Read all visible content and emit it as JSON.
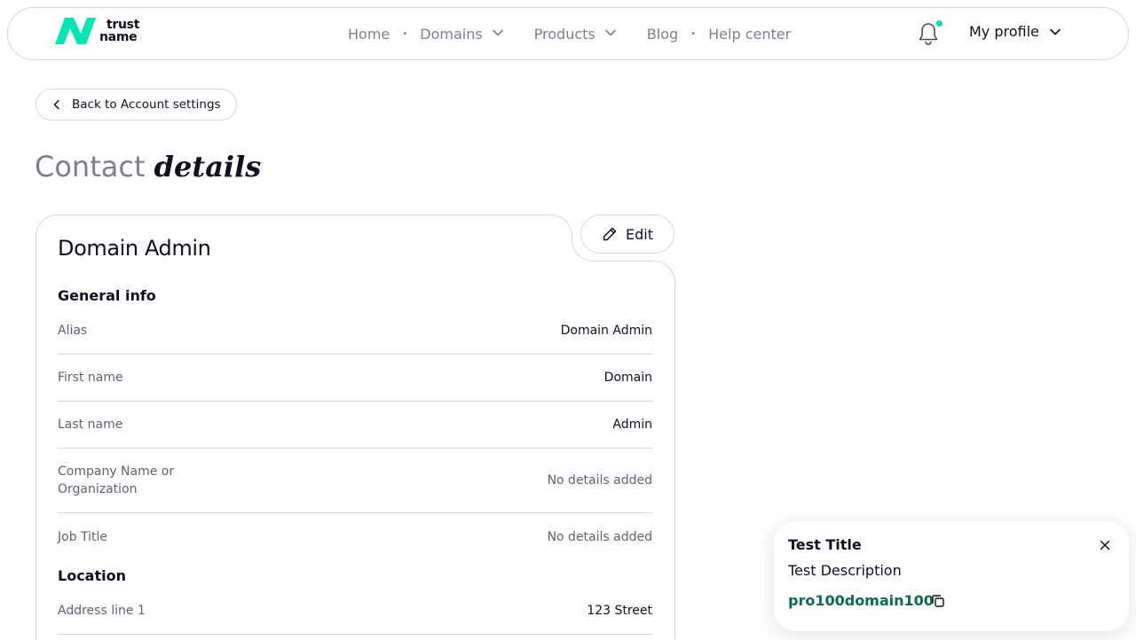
{
  "brand": {
    "line1": "trust",
    "line2": "name",
    "accent": "#00e5b4"
  },
  "nav": {
    "home": "Home",
    "domains": "Domains",
    "products": "Products",
    "blog": "Blog",
    "help": "Help center"
  },
  "header": {
    "profile_label": "My profile",
    "notification_icon": "bell-icon",
    "notification_dot_color": "#00e0b0"
  },
  "back_label": "Back to Account settings",
  "page_title": {
    "part1": "Contact",
    "part2": "details"
  },
  "card": {
    "title": "Domain Admin",
    "edit_label": "Edit",
    "general_info_title": "General info",
    "general_rows": [
      {
        "label": "Alias",
        "value": "Domain Admin"
      },
      {
        "label": "First name",
        "value": "Domain"
      },
      {
        "label": "Last name",
        "value": "Admin"
      },
      {
        "label": "Company Name or Organization",
        "value": "No details added"
      },
      {
        "label": "Job Title",
        "value": "No details added"
      }
    ],
    "location_title": "Location",
    "location_rows": [
      {
        "label": "Address line 1",
        "value": "123 Street"
      }
    ]
  },
  "toast": {
    "title": "Test Title",
    "description": "Test Description",
    "code": "pro100domain100",
    "code_color": "#0a6b4e"
  }
}
